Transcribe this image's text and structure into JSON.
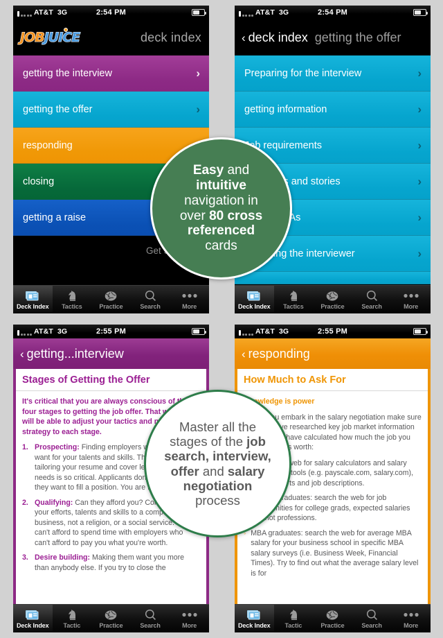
{
  "status_bar": {
    "carrier": "AT&T",
    "network": "3G",
    "time_top": "2:54 PM",
    "time_bottom": "2:55 PM"
  },
  "tabbar": {
    "items": [
      {
        "label": "Deck Index",
        "icon": "cards-icon",
        "active": true
      },
      {
        "label": "Tactics",
        "icon": "knight-chess-icon",
        "active": false
      },
      {
        "label": "Practice",
        "icon": "brain-icon",
        "active": false
      },
      {
        "label": "Search",
        "icon": "magnifier-icon",
        "active": false
      },
      {
        "label": "More",
        "icon": "ellipsis-icon",
        "active": false
      }
    ],
    "items_bottom": [
      {
        "label": "Deck Index",
        "icon": "cards-icon",
        "active": true
      },
      {
        "label": "Tactic",
        "icon": "knight-chess-icon",
        "active": false
      },
      {
        "label": "Practice",
        "icon": "brain-icon",
        "active": false
      },
      {
        "label": "Search",
        "icon": "magnifier-icon",
        "active": false
      },
      {
        "label": "More",
        "icon": "ellipsis-icon",
        "active": false
      }
    ]
  },
  "panel_top_left": {
    "logo": {
      "part1": "JOB",
      "part2": "JUICE"
    },
    "nav_title": "deck index",
    "rows": [
      {
        "label": "getting the interview",
        "color": "purple"
      },
      {
        "label": "getting the offer",
        "color": "cyan"
      },
      {
        "label": "responding",
        "color": "orange"
      },
      {
        "label": "closing",
        "color": "green"
      },
      {
        "label": "getting a raise",
        "color": "blue"
      }
    ],
    "footer_link": "Get Started"
  },
  "panel_top_right": {
    "back_label": "deck index",
    "nav_subtitle": "getting the offer",
    "rows": [
      {
        "label": "Preparing for the interview"
      },
      {
        "label": "getting information"
      },
      {
        "label": "Job requirements"
      },
      {
        "label": "Examples and stories"
      },
      {
        "label": "Tough Q&As"
      },
      {
        "label": "Engaging the interviewer"
      }
    ]
  },
  "panel_bottom_left": {
    "back_label": "getting...interview",
    "card_title": "Stages of Getting the Offer",
    "lead": "It's critical that you are always conscious of the four stages to getting the job offer. That way you will be able to adjust your tactics and negotiation strategy to each stage.",
    "steps": [
      {
        "num": "1.",
        "term": "Prospecting:",
        "text": " Finding employers who need or want for your talents and skills. This is why tailoring your resume and cover letter to their needs is so critical. Applicants don't want a job, they want to fill a position. You are filling a need."
      },
      {
        "num": "2.",
        "term": "Qualifying:",
        "text": " Can they afford you? Committing all of your efforts, talents and skills to a company is a business, not a religion, or a social service. You can't afford to spend time with employers who can't afford to pay you what you're worth."
      },
      {
        "num": "3.",
        "term": "Desire building:",
        "text": " Making them want you more than anybody else. If you try to close the"
      }
    ]
  },
  "panel_bottom_right": {
    "back_label": "responding",
    "card_title": "How Much to Ask For",
    "lead": "Knowledge is power",
    "intro": "Before you embark in the salary negotiation make sure that you have researched key job market information and that you have calculated how much the job you were offered is worth:",
    "bullets": [
      "Search the web for salary calculators and salary comparison tools (e.g. payscale.com, salary.com), salary reports and job descriptions.",
      "College graduates: search the web for job opportunities for college grads, expected salaries and hot professions.",
      "MBA graduates: search the web for average MBA salary for your business school in specific MBA salary surveys (i.e. Business Week, Financial Times). Try to find out what the average salary level is for"
    ]
  },
  "callouts": {
    "top": {
      "line1_bold": "Easy",
      "line1_rest": " and",
      "line2_bold": "intuitive",
      "line3": "navigation in",
      "line4_rest": "over ",
      "line4_bold": "80 cross",
      "line5_bold": "referenced",
      "line6": "cards",
      "full_text": "Easy and intuitive navigation in over 80 cross referenced cards"
    },
    "bottom": {
      "full_text": "Master all the stages of the job search, interview, offer and salary negotiation process",
      "line1": "Master all the",
      "line2_rest": "stages of the ",
      "line2_bold": "job",
      "line3_bold": "search, interview,",
      "line4_bold_a": "offer",
      "line4_rest": " and ",
      "line4_bold_b": "salary",
      "line5_bold": "negotiation",
      "line6": "process"
    }
  },
  "colors": {
    "purple": "#8d2a85",
    "cyan": "#06a5ce",
    "orange": "#ef9504",
    "green": "#06693a",
    "blue": "#0b51b5",
    "callout_green": "#467e53",
    "callout_border": "#2e7d4a",
    "page_bg": "#d2d2d2"
  }
}
